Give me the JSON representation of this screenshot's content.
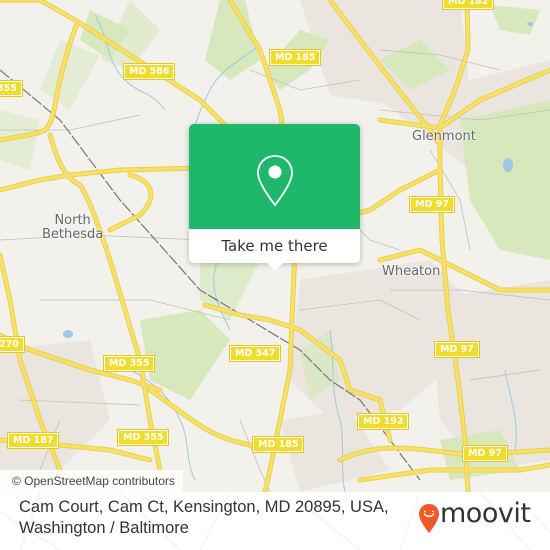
{
  "map": {
    "colors": {
      "background": "#f2f1ec",
      "road_major": "#f7e06a",
      "road_casing": "#e9cf4a",
      "road_minor": "#b8b5ad",
      "park": "#d6e8bc",
      "urban": "#ebe5df",
      "water": "#9cc9e6",
      "rail": "#777777"
    },
    "route_shields": [
      {
        "label": "MD 586"
      },
      {
        "label": "MD 185"
      },
      {
        "label": "MD 182"
      },
      {
        "label": "355"
      },
      {
        "label": "MD 97"
      },
      {
        "label": "270"
      },
      {
        "label": "MD 355"
      },
      {
        "label": "MD 547"
      },
      {
        "label": "MD 97"
      },
      {
        "label": "MD 192"
      },
      {
        "label": "MD 187"
      },
      {
        "label": "MD 355"
      },
      {
        "label": "MD 185"
      },
      {
        "label": "MD 97"
      }
    ],
    "places": [
      {
        "label": "Glenmont"
      },
      {
        "label": "North\nBethesda"
      },
      {
        "label": "Wheaton"
      }
    ],
    "attribution": "© OpenStreetMap contributors"
  },
  "popup": {
    "icon": "map-pin-icon",
    "accent_color": "#1fb86a",
    "button_label": "Take me there"
  },
  "footer": {
    "address_line1": "Cam Court, Cam Ct, Kensington, MD 20895, USA,",
    "address_line2": "Washington / Baltimore",
    "logo_text": "moovit",
    "logo_color": "#f05a28"
  }
}
